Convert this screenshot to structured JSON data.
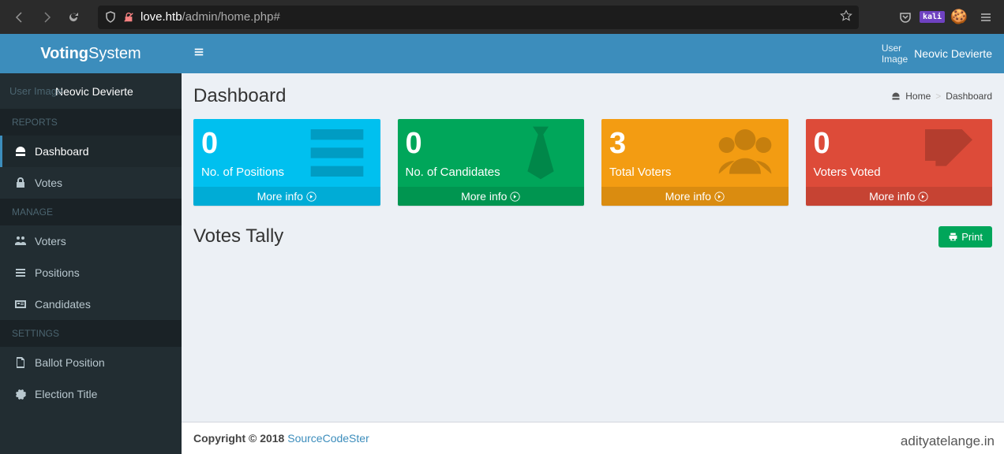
{
  "browser": {
    "url_host": "love.htb",
    "url_path": "/admin/home.php#",
    "kali": "kali"
  },
  "brand": {
    "bold": "Voting",
    "light": "System"
  },
  "user": {
    "dim": "User Image",
    "name": "Neovic Devierte"
  },
  "topnav": {
    "user_img": "User\nImage",
    "user_name": "Neovic Devierte"
  },
  "sidebar": {
    "section1": "REPORTS",
    "dashboard": "Dashboard",
    "votes": "Votes",
    "section2": "MANAGE",
    "voters": "Voters",
    "positions": "Positions",
    "candidates": "Candidates",
    "section3": "SETTINGS",
    "ballot": "Ballot Position",
    "election": "Election Title"
  },
  "page": {
    "title": "Dashboard",
    "bc_home": "Home",
    "bc_current": "Dashboard"
  },
  "stats": [
    {
      "value": "0",
      "label": "No. of Positions",
      "more": "More info "
    },
    {
      "value": "0",
      "label": "No. of Candidates",
      "more": "More info "
    },
    {
      "value": "3",
      "label": "Total Voters",
      "more": "More info "
    },
    {
      "value": "0",
      "label": "Voters Voted",
      "more": "More info "
    }
  ],
  "tally": {
    "title": "Votes Tally",
    "print": "Print"
  },
  "footer": {
    "copyright": "Copyright © 2018 ",
    "link": "SourceCodeSter"
  },
  "watermark": "adityatelange.in"
}
